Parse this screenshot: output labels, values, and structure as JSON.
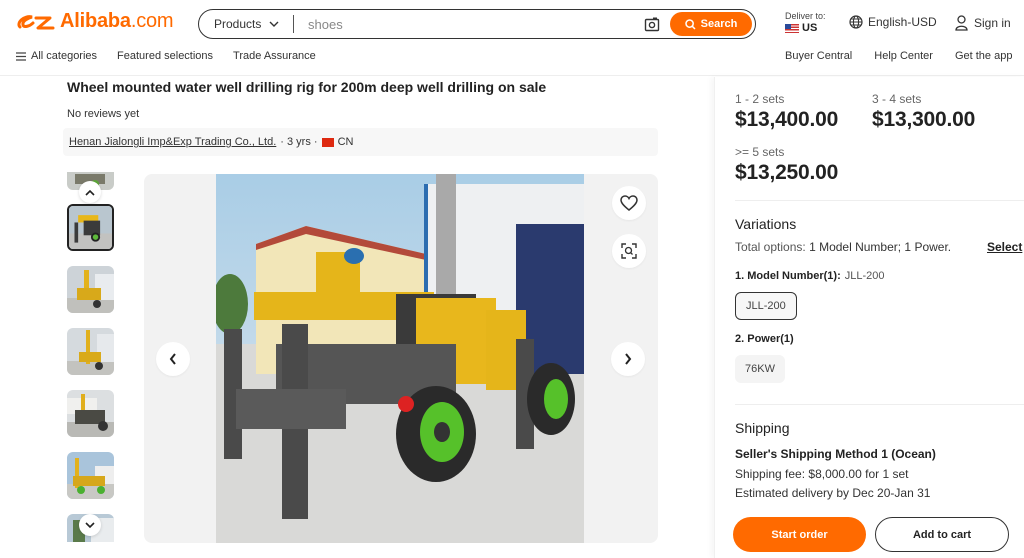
{
  "header": {
    "logo_text": "Alibaba",
    "logo_suffix": ".com",
    "search": {
      "category": "Products",
      "query": "shoes",
      "button_label": "Search"
    },
    "deliver_to_label": "Deliver to:",
    "deliver_to_country": "US",
    "language": "English-USD",
    "sign_in": "Sign in",
    "nav_left": [
      "All categories",
      "Featured selections",
      "Trade Assurance"
    ],
    "nav_right": [
      "Buyer Central",
      "Help Center",
      "Get the app"
    ]
  },
  "product": {
    "title": "Wheel mounted water well drilling rig for 200m deep well drilling on sale",
    "reviews": "No reviews yet",
    "supplier_name": "Henan Jialongli Imp&Exp Trading Co., Ltd.",
    "supplier_years": "· 3 yrs ·",
    "supplier_country": "CN",
    "thumbnail_count": 6,
    "active_thumbnail_index": 1
  },
  "pricing": {
    "tiers": [
      {
        "quantity": "1 - 2 sets",
        "price": "$13,400.00"
      },
      {
        "quantity": "3 - 4 sets",
        "price": "$13,300.00"
      },
      {
        "quantity": ">= 5 sets",
        "price": "$13,250.00"
      }
    ]
  },
  "variations": {
    "title": "Variations",
    "total_prefix": "Total options:",
    "total_value": "1 Model Number; 1 Power.",
    "select_link": "Select",
    "model_label": "1. Model Number(1):",
    "model_value": "JLL-200",
    "model_options": [
      "JLL-200"
    ],
    "power_label": "2. Power(1)",
    "power_options": [
      "76KW"
    ]
  },
  "shipping": {
    "title": "Shipping",
    "method": "Seller's Shipping Method 1 (Ocean)",
    "fee": "Shipping fee: $8,000.00 for 1 set",
    "delivery": "Estimated delivery by Dec 20-Jan 31"
  },
  "actions": {
    "start_order": "Start order",
    "add_to_cart": "Add to cart"
  },
  "colors": {
    "brand": "#ff6a00",
    "text": "#222222"
  }
}
